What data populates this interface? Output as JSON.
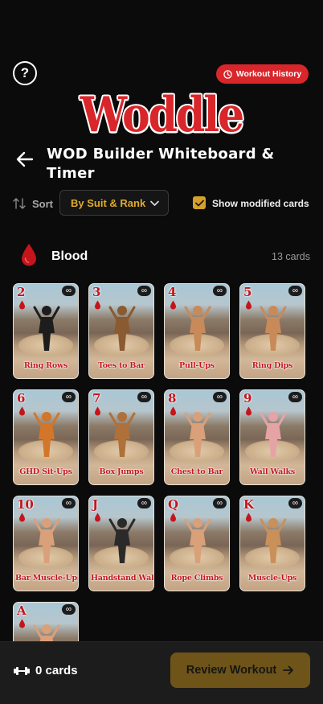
{
  "header": {
    "help_label": "?",
    "history_label": "Workout History",
    "logo_text": "Woddle",
    "title": "WOD Builder Whiteboard & Timer"
  },
  "controls": {
    "sort_label": "Sort",
    "sort_value": "By Suit & Rank",
    "show_modified_label": "Show modified cards",
    "show_modified_checked": true
  },
  "suit": {
    "name": "Blood",
    "count_label": "13 cards",
    "icon": "blood-drop-icon",
    "color": "#c4151b"
  },
  "cards": [
    {
      "rank": "2",
      "name": "Ring Rows",
      "badge": "∞",
      "figure": "panther"
    },
    {
      "rank": "3",
      "name": "Toes to Bar",
      "badge": "∞",
      "figure": "monkey"
    },
    {
      "rank": "4",
      "name": "Pull-Ups",
      "badge": "∞",
      "figure": "strongman"
    },
    {
      "rank": "5",
      "name": "Ring Dips",
      "badge": "∞",
      "figure": "strongman"
    },
    {
      "rank": "6",
      "name": "GHD Sit-Ups",
      "badge": "∞",
      "figure": "tiger"
    },
    {
      "rank": "7",
      "name": "Box Jumps",
      "badge": "∞",
      "figure": "kangaroo"
    },
    {
      "rank": "8",
      "name": "Chest to Bar",
      "badge": "∞",
      "figure": "acrobat"
    },
    {
      "rank": "9",
      "name": "Wall Walks",
      "badge": "∞",
      "figure": "pig"
    },
    {
      "rank": "10",
      "name": "Bar Muscle-Ups",
      "badge": "∞",
      "figure": "acrobat"
    },
    {
      "rank": "J",
      "name": "Handstand Walk",
      "badge": "∞",
      "figure": "zebra"
    },
    {
      "rank": "Q",
      "name": "Rope Climbs",
      "badge": "∞",
      "figure": "acrobat"
    },
    {
      "rank": "K",
      "name": "Muscle-Ups",
      "badge": "∞",
      "figure": "bulldog"
    },
    {
      "rank": "A",
      "name": "",
      "badge": "∞",
      "figure": "acrobat"
    }
  ],
  "bottom_bar": {
    "cards_count": "0 cards",
    "review_label": "Review Workout"
  },
  "colors": {
    "accent_red": "#d8262b",
    "accent_gold": "#e2ac2a",
    "review_button": "#6e5418"
  }
}
